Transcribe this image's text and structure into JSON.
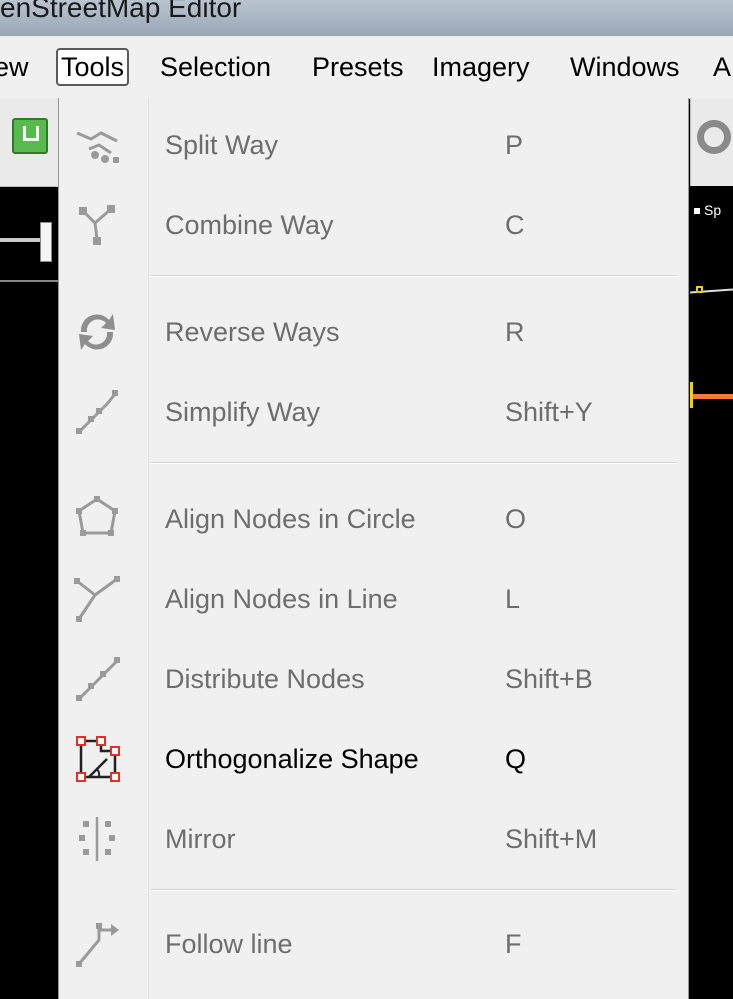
{
  "window": {
    "title_fragment": "enStreetMap Editor"
  },
  "menubar": {
    "items": [
      {
        "label": "ew"
      },
      {
        "label": "Tools"
      },
      {
        "label": "Selection"
      },
      {
        "label": "Presets"
      },
      {
        "label": "Imagery"
      },
      {
        "label": "Windows"
      },
      {
        "label": "A"
      }
    ]
  },
  "map": {
    "label_fragment": "Sp"
  },
  "tools_menu": {
    "items": [
      {
        "label": "Split Way",
        "shortcut": "P",
        "icon": "split-way-icon",
        "enabled": false
      },
      {
        "label": "Combine Way",
        "shortcut": "C",
        "icon": "combine-way-icon",
        "enabled": false
      },
      {
        "label": "Reverse Ways",
        "shortcut": "R",
        "icon": "reverse-ways-icon",
        "enabled": false
      },
      {
        "label": "Simplify Way",
        "shortcut": "Shift+Y",
        "icon": "simplify-way-icon",
        "enabled": false
      },
      {
        "label": "Align Nodes in Circle",
        "shortcut": "O",
        "icon": "align-circle-icon",
        "enabled": false
      },
      {
        "label": "Align Nodes in Line",
        "shortcut": "L",
        "icon": "align-line-icon",
        "enabled": false
      },
      {
        "label": "Distribute Nodes",
        "shortcut": "Shift+B",
        "icon": "distribute-nodes-icon",
        "enabled": false
      },
      {
        "label": "Orthogonalize Shape",
        "shortcut": "Q",
        "icon": "orthogonalize-icon",
        "enabled": true
      },
      {
        "label": "Mirror",
        "shortcut": "Shift+M",
        "icon": "mirror-icon",
        "enabled": false
      },
      {
        "label": "Follow line",
        "shortcut": "F",
        "icon": "follow-line-icon",
        "enabled": false
      }
    ]
  },
  "colors": {
    "menu_bg": "#f0f0f0",
    "disabled_text": "#6d6d6d",
    "enabled_text": "#000000",
    "orthogonalize_accent": "#e0302a"
  }
}
